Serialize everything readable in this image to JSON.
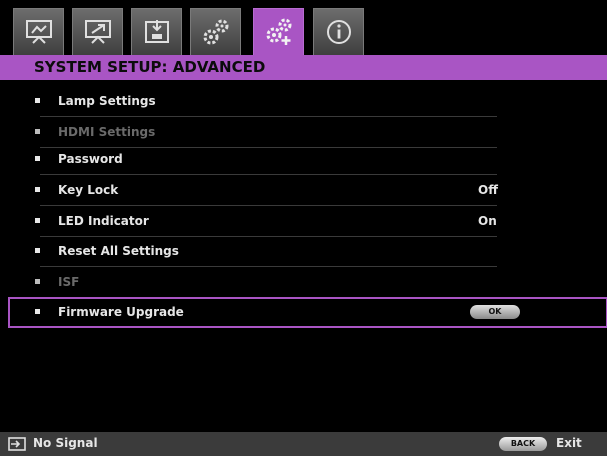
{
  "tabs": [
    {
      "icon": "picture-icon",
      "active": false
    },
    {
      "icon": "display-icon",
      "active": false
    },
    {
      "icon": "setup-icon",
      "active": false
    },
    {
      "icon": "system-basic-icon",
      "active": false
    },
    {
      "icon": "system-advanced-icon",
      "active": true
    },
    {
      "icon": "information-icon",
      "active": false
    }
  ],
  "title": "SYSTEM SETUP: ADVANCED",
  "menu": {
    "items": [
      {
        "label": "Lamp Settings",
        "value": "",
        "enabled": true
      },
      {
        "label": "HDMI Settings",
        "value": "",
        "enabled": false
      },
      {
        "label": "Password",
        "value": "",
        "enabled": true
      },
      {
        "label": "Key Lock",
        "value": "Off",
        "enabled": true
      },
      {
        "label": "LED Indicator",
        "value": "On",
        "enabled": true
      },
      {
        "label": "Reset All Settings",
        "value": "",
        "enabled": true
      },
      {
        "label": "ISF",
        "value": "",
        "enabled": false
      },
      {
        "label": "Firmware Upgrade",
        "button": "OK",
        "enabled": true,
        "selected": true
      }
    ]
  },
  "status": {
    "source_icon": "input-source-icon",
    "signal": "No Signal",
    "back_button": "BACK",
    "exit_label": "Exit"
  },
  "colors": {
    "accent": "#a955c4",
    "background": "#000000",
    "statusbar": "#3b3b3b"
  }
}
